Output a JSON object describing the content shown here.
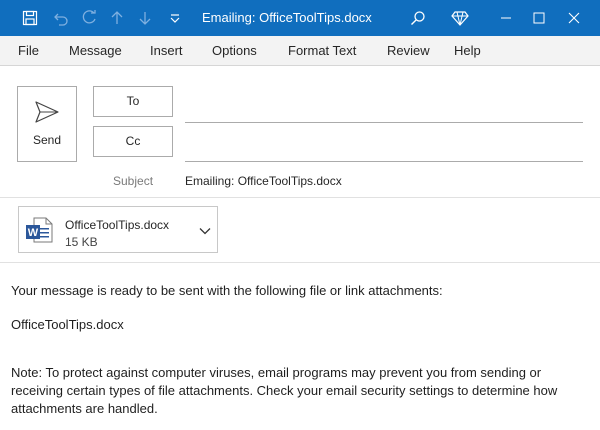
{
  "window": {
    "title": "Emailing: OfficeToolTips.docx",
    "title_bar_color": "#106ebe"
  },
  "quick_access": {
    "icons": [
      "save-icon",
      "undo-icon",
      "redo-icon",
      "up-arrow-icon",
      "down-arrow-icon",
      "customize-dropdown-icon"
    ]
  },
  "menu": {
    "items": [
      {
        "label": "File"
      },
      {
        "label": "Message"
      },
      {
        "label": "Insert"
      },
      {
        "label": "Options"
      },
      {
        "label": "Format Text"
      },
      {
        "label": "Review"
      },
      {
        "label": "Help"
      }
    ]
  },
  "compose": {
    "send_label": "Send",
    "to_label": "To",
    "cc_label": "Cc",
    "to_value": "",
    "cc_value": "",
    "subject_label": "Subject",
    "subject_value": "Emailing: OfficeToolTips.docx"
  },
  "attachment": {
    "name": "OfficeToolTips.docx",
    "size": "15 KB",
    "icon": "word-document-icon"
  },
  "body": {
    "line1": "Your message is ready to be sent with the following file or link attachments:",
    "line2": "OfficeToolTips.docx",
    "note": "Note: To protect against computer viruses, email programs may prevent you from sending or receiving certain types of file attachments. Check your email security settings to determine how attachments are handled."
  }
}
